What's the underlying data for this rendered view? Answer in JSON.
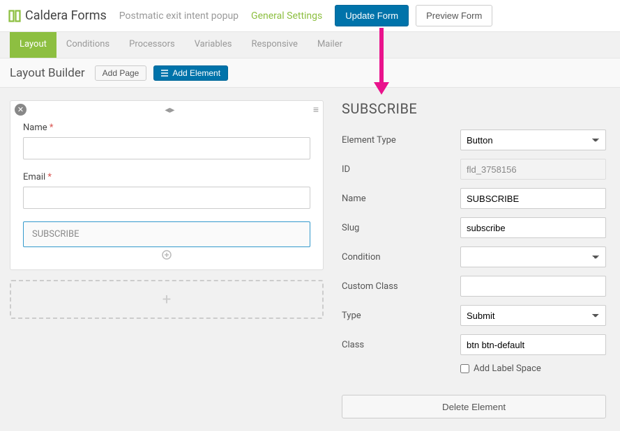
{
  "header": {
    "brand": "Caldera Forms",
    "breadcrumb": "Postmatic exit intent popup",
    "settings_link": "General Settings",
    "update_btn": "Update Form",
    "preview_btn": "Preview Form"
  },
  "tabs": [
    "Layout",
    "Conditions",
    "Processors",
    "Variables",
    "Responsive",
    "Mailer"
  ],
  "subbar": {
    "title": "Layout Builder",
    "add_page": "Add Page",
    "add_element": "Add Element"
  },
  "canvas": {
    "fields": [
      {
        "label": "Name",
        "required": true
      },
      {
        "label": "Email",
        "required": true
      }
    ],
    "subscribe_label": "SUBSCRIBE"
  },
  "panel": {
    "title": "SUBSCRIBE",
    "rows": {
      "element_type_label": "Element Type",
      "element_type_value": "Button",
      "id_label": "ID",
      "id_value": "fld_3758156",
      "name_label": "Name",
      "name_value": "SUBSCRIBE",
      "slug_label": "Slug",
      "slug_value": "subscribe",
      "condition_label": "Condition",
      "condition_value": "",
      "custom_class_label": "Custom Class",
      "custom_class_value": "",
      "type_label": "Type",
      "type_value": "Submit",
      "class_label": "Class",
      "class_value": "btn btn-default",
      "add_label_space": "Add Label Space",
      "delete_btn": "Delete Element"
    }
  }
}
